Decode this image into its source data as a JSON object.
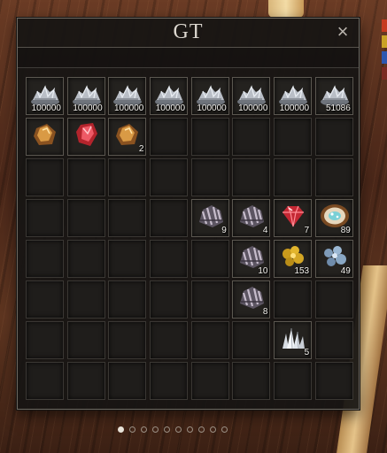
{
  "window": {
    "title": "GT",
    "close_symbol": "×"
  },
  "inventory": {
    "rows": [
      [
        {
          "icon": "ore-pile-icon",
          "count": "100000"
        },
        {
          "icon": "ore-pile-icon",
          "count": "100000"
        },
        {
          "icon": "ore-pile-icon",
          "count": "100000"
        },
        {
          "icon": "ore-pile-icon",
          "count": "100000"
        },
        {
          "icon": "ore-pile-icon",
          "count": "100000"
        },
        {
          "icon": "ore-pile-icon",
          "count": "100000"
        },
        {
          "icon": "ore-pile-icon",
          "count": "100000"
        },
        {
          "icon": "ore-pile-icon",
          "count": "51086"
        }
      ],
      [
        {
          "icon": "amber-gem-icon",
          "count": ""
        },
        {
          "icon": "red-crystal-icon",
          "count": ""
        },
        {
          "icon": "amber-gem-icon",
          "count": "2"
        },
        null,
        null,
        null,
        null,
        null
      ],
      [
        null,
        null,
        null,
        null,
        null,
        null,
        null,
        null
      ],
      [
        null,
        null,
        null,
        null,
        {
          "icon": "ore-rock-icon",
          "count": "9"
        },
        {
          "icon": "ore-rock-icon",
          "count": "4"
        },
        {
          "icon": "ruby-icon",
          "count": "7"
        },
        {
          "icon": "geode-icon",
          "count": "89"
        }
      ],
      [
        null,
        null,
        null,
        null,
        null,
        {
          "icon": "ore-rock-icon",
          "count": "10"
        },
        {
          "icon": "gold-nugget-icon",
          "count": "153"
        },
        {
          "icon": "silver-nugget-icon",
          "count": "49"
        }
      ],
      [
        null,
        null,
        null,
        null,
        null,
        {
          "icon": "ore-rock-icon",
          "count": "8"
        },
        null,
        null
      ],
      [
        null,
        null,
        null,
        null,
        null,
        null,
        {
          "icon": "quartz-cluster-icon",
          "count": "5"
        },
        null
      ],
      [
        null,
        null,
        null,
        null,
        null,
        null,
        null,
        null
      ]
    ]
  },
  "pagination": {
    "pages": 10,
    "current": 1
  },
  "colors": {
    "side_swatches": [
      "#c63a1f",
      "#c9a227",
      "#2d57b0",
      "#7a2a22"
    ]
  }
}
